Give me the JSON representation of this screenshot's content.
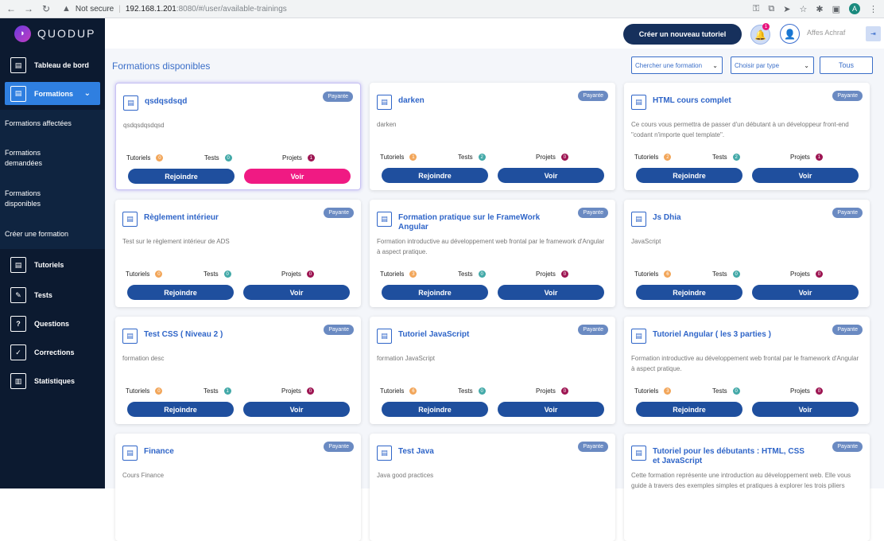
{
  "browser": {
    "security": "Not secure",
    "url_host": "192.168.1.201",
    "url_path": ":8080/#/user/available-trainings",
    "profile_initial": "A"
  },
  "sidebar": {
    "logo": "QUODUP",
    "items": [
      {
        "label": "Tableau de bord",
        "icon": "dashboard-icon"
      },
      {
        "label": "Formations",
        "icon": "formations-icon"
      },
      {
        "label": "Tutoriels",
        "icon": "tutorials-icon"
      },
      {
        "label": "Tests",
        "icon": "tests-icon"
      },
      {
        "label": "Questions",
        "icon": "questions-icon"
      },
      {
        "label": "Corrections",
        "icon": "corrections-icon"
      },
      {
        "label": "Statistiques",
        "icon": "statistics-icon"
      }
    ],
    "submenu": [
      "Formations affectées",
      "Formations demandées",
      "Formations disponibles",
      "Créer une formation"
    ]
  },
  "topbar": {
    "create_label": "Créer un nouveau tutoriel",
    "notif_count": "1",
    "user_name": "Affes Achraf"
  },
  "main": {
    "title": "Formations disponibles",
    "search_placeholder": "Chercher une formation",
    "type_placeholder": "Choisir par type",
    "all_label": "Tous",
    "labels": {
      "tutorials": "Tutoriels",
      "tests": "Tests",
      "projects": "Projets",
      "join": "Rejoindre",
      "view": "Voir",
      "badge": "Payante"
    },
    "cards": [
      {
        "title": "qsdqsdsqd",
        "desc": "qsdqsdqsdqsd",
        "tutorials": "0",
        "tests": "0",
        "projects": "1"
      },
      {
        "title": "darken",
        "desc": "darken",
        "tutorials": "1",
        "tests": "2",
        "projects": "0"
      },
      {
        "title": "HTML cours complet",
        "desc": "Ce cours vous permettra de passer d'un débutant à un développeur front-end \"codant n'importe quel template\".",
        "tutorials": "2",
        "tests": "2",
        "projects": "1"
      },
      {
        "title": "Règlement intérieur",
        "desc": "Test sur le règlement intérieur de ADS",
        "tutorials": "0",
        "tests": "0",
        "projects": "0"
      },
      {
        "title": "Formation pratique sur le FrameWork Angular",
        "desc": "Formation introductive au développement web frontal par le framework d'Angular à aspect pratique.",
        "tutorials": "3",
        "tests": "0",
        "projects": "0"
      },
      {
        "title": "Js Dhia",
        "desc": "JavaScript",
        "tutorials": "6",
        "tests": "0",
        "projects": "0"
      },
      {
        "title": "Test CSS ( Niveau 2 )",
        "desc": "formation desc",
        "tutorials": "0",
        "tests": "1",
        "projects": "0"
      },
      {
        "title": "Tutoriel JavaScript",
        "desc": "formation JavaScript",
        "tutorials": "6",
        "tests": "0",
        "projects": "0"
      },
      {
        "title": "Tutoriel Angular ( les 3 parties )",
        "desc": "Formation introductive au développement web frontal par le framework d'Angular à aspect pratique.",
        "tutorials": "3",
        "tests": "0",
        "projects": "0"
      },
      {
        "title": "Finance",
        "desc": "Cours Finance",
        "tutorials": "",
        "tests": "",
        "projects": ""
      },
      {
        "title": "Test Java",
        "desc": "Java good practices",
        "tutorials": "",
        "tests": "",
        "projects": ""
      },
      {
        "title": "Tutoriel pour les débutants : HTML, CSS et JavaScript",
        "desc": "Cette formation représente une introduction au développement web. Elle vous guide à travers des exemples simples et pratiques à explorer les trois piliers",
        "tutorials": "",
        "tests": "",
        "projects": ""
      }
    ]
  }
}
